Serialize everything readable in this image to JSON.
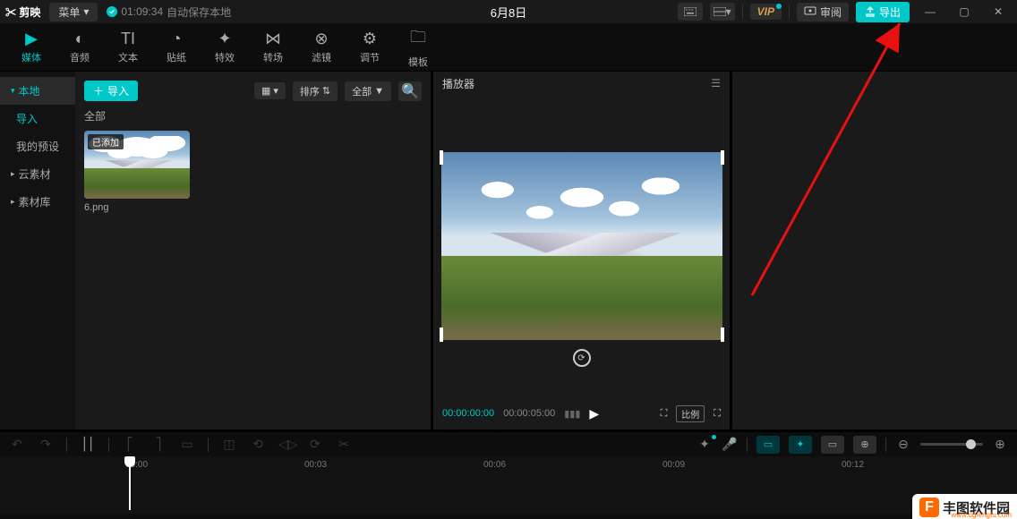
{
  "titlebar": {
    "app": "剪映",
    "menu": "菜单",
    "autosave_time": "01:09:34",
    "autosave_text": "自动保存本地",
    "date": "6月8日",
    "vip": "VIP",
    "review": "审阅",
    "export": "导出"
  },
  "tooltabs": [
    {
      "label": "媒体"
    },
    {
      "label": "音频"
    },
    {
      "label": "文本"
    },
    {
      "label": "贴纸"
    },
    {
      "label": "特效"
    },
    {
      "label": "转场"
    },
    {
      "label": "滤镜"
    },
    {
      "label": "调节"
    },
    {
      "label": "模板"
    }
  ],
  "sidebar": {
    "local": "本地",
    "import": "导入",
    "preset": "我的预设",
    "cloud": "云素材",
    "library": "素材库"
  },
  "media": {
    "import": "导入",
    "sort": "排序",
    "all": "全部",
    "all_label": "全部",
    "thumb_badge": "已添加",
    "thumb_name": "6.png"
  },
  "player": {
    "title": "播放器",
    "cur": "00:00:00:00",
    "tot": "00:00:05:00",
    "ratio": "比例"
  },
  "ruler": {
    "t0": "00:00",
    "t1": "00:03",
    "t2": "00:06",
    "t3": "00:09",
    "t4": "00:12"
  },
  "watermark": {
    "name": "丰图软件园",
    "url": "www.dgfengtu.com",
    "logo": "F"
  }
}
